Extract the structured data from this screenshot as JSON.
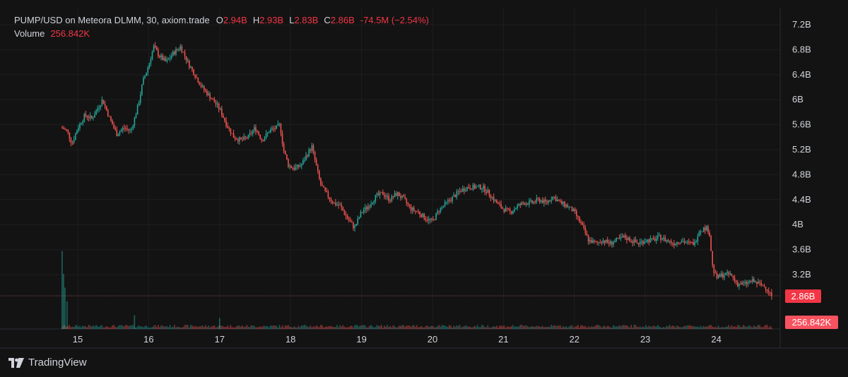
{
  "legend": {
    "symbol": "PUMP/USD on Meteora DLMM, 30, axiom.trade",
    "open_label": "O",
    "open": "2.94B",
    "high_label": "H",
    "high": "2.93B",
    "low_label": "L",
    "low": "2.83B",
    "close_label": "C",
    "close": "2.86B",
    "change": "-74.5M (−2.54%)",
    "volume_label": "Volume",
    "volume": "256.842K"
  },
  "price_badge": "2.86B",
  "volume_badge": "256.842K",
  "brand": {
    "name": "TradingView",
    "logo_icon": "tradingview-logo-icon"
  },
  "colors": {
    "up": "#26a69a",
    "down": "#ef5350",
    "background": "#131313",
    "badge": "#f23645"
  },
  "chart_data": {
    "type": "candlestick",
    "y_ticks": [
      "7.2B",
      "6.8B",
      "6.4B",
      "6B",
      "5.6B",
      "5.2B",
      "4.8B",
      "4.4B",
      "4B",
      "3.6B",
      "3.2B"
    ],
    "y_values": [
      7.2,
      6.8,
      6.4,
      6.0,
      5.6,
      5.2,
      4.8,
      4.4,
      4.0,
      3.6,
      3.2
    ],
    "x_ticks": [
      "15",
      "16",
      "17",
      "18",
      "19",
      "20",
      "21",
      "22",
      "23",
      "24"
    ],
    "ylim": [
      2.75,
      7.35
    ],
    "grid": true,
    "close_path": [
      [
        14.78,
        5.55
      ],
      [
        14.85,
        5.5
      ],
      [
        14.92,
        5.3
      ],
      [
        15.0,
        5.55
      ],
      [
        15.1,
        5.75
      ],
      [
        15.2,
        5.7
      ],
      [
        15.3,
        5.9
      ],
      [
        15.35,
        6.0
      ],
      [
        15.45,
        5.7
      ],
      [
        15.55,
        5.45
      ],
      [
        15.65,
        5.55
      ],
      [
        15.75,
        5.5
      ],
      [
        15.85,
        5.9
      ],
      [
        15.92,
        6.3
      ],
      [
        16.0,
        6.55
      ],
      [
        16.07,
        6.85
      ],
      [
        16.15,
        6.7
      ],
      [
        16.25,
        6.6
      ],
      [
        16.35,
        6.75
      ],
      [
        16.45,
        6.85
      ],
      [
        16.55,
        6.6
      ],
      [
        16.65,
        6.4
      ],
      [
        16.75,
        6.2
      ],
      [
        16.9,
        6.0
      ],
      [
        17.0,
        5.85
      ],
      [
        17.1,
        5.6
      ],
      [
        17.2,
        5.4
      ],
      [
        17.3,
        5.35
      ],
      [
        17.4,
        5.4
      ],
      [
        17.5,
        5.55
      ],
      [
        17.6,
        5.35
      ],
      [
        17.7,
        5.5
      ],
      [
        17.8,
        5.55
      ],
      [
        17.85,
        5.6
      ],
      [
        17.9,
        5.2
      ],
      [
        17.97,
        4.95
      ],
      [
        18.05,
        4.9
      ],
      [
        18.15,
        4.95
      ],
      [
        18.22,
        5.1
      ],
      [
        18.3,
        5.25
      ],
      [
        18.35,
        5.0
      ],
      [
        18.42,
        4.65
      ],
      [
        18.5,
        4.5
      ],
      [
        18.6,
        4.35
      ],
      [
        18.7,
        4.3
      ],
      [
        18.8,
        4.1
      ],
      [
        18.9,
        3.95
      ],
      [
        19.0,
        4.2
      ],
      [
        19.1,
        4.3
      ],
      [
        19.2,
        4.45
      ],
      [
        19.3,
        4.5
      ],
      [
        19.4,
        4.4
      ],
      [
        19.5,
        4.5
      ],
      [
        19.6,
        4.4
      ],
      [
        19.7,
        4.25
      ],
      [
        19.8,
        4.2
      ],
      [
        19.9,
        4.1
      ],
      [
        20.0,
        4.05
      ],
      [
        20.1,
        4.25
      ],
      [
        20.2,
        4.35
      ],
      [
        20.3,
        4.45
      ],
      [
        20.4,
        4.55
      ],
      [
        20.5,
        4.6
      ],
      [
        20.6,
        4.6
      ],
      [
        20.7,
        4.6
      ],
      [
        20.8,
        4.5
      ],
      [
        20.9,
        4.35
      ],
      [
        21.0,
        4.25
      ],
      [
        21.1,
        4.2
      ],
      [
        21.2,
        4.3
      ],
      [
        21.3,
        4.35
      ],
      [
        21.4,
        4.35
      ],
      [
        21.5,
        4.4
      ],
      [
        21.6,
        4.35
      ],
      [
        21.7,
        4.45
      ],
      [
        21.8,
        4.35
      ],
      [
        21.9,
        4.3
      ],
      [
        22.0,
        4.2
      ],
      [
        22.1,
        4.0
      ],
      [
        22.2,
        3.75
      ],
      [
        22.3,
        3.7
      ],
      [
        22.4,
        3.75
      ],
      [
        22.5,
        3.7
      ],
      [
        22.6,
        3.75
      ],
      [
        22.7,
        3.8
      ],
      [
        22.8,
        3.75
      ],
      [
        22.9,
        3.7
      ],
      [
        23.0,
        3.75
      ],
      [
        23.1,
        3.75
      ],
      [
        23.2,
        3.8
      ],
      [
        23.3,
        3.75
      ],
      [
        23.4,
        3.7
      ],
      [
        23.5,
        3.75
      ],
      [
        23.6,
        3.7
      ],
      [
        23.7,
        3.7
      ],
      [
        23.75,
        3.9
      ],
      [
        23.85,
        3.95
      ],
      [
        23.9,
        3.9
      ],
      [
        23.95,
        3.3
      ],
      [
        24.0,
        3.15
      ],
      [
        24.1,
        3.2
      ],
      [
        24.2,
        3.2
      ],
      [
        24.3,
        3.05
      ],
      [
        24.4,
        3.05
      ],
      [
        24.5,
        3.1
      ],
      [
        24.6,
        3.05
      ],
      [
        24.7,
        3.0
      ],
      [
        24.78,
        2.86
      ]
    ],
    "volume_spikes": [
      [
        14.78,
        0.85
      ],
      [
        14.8,
        0.6
      ],
      [
        14.82,
        0.45
      ],
      [
        14.85,
        0.3
      ],
      [
        15.8,
        0.15
      ],
      [
        17.0,
        0.12
      ]
    ]
  }
}
